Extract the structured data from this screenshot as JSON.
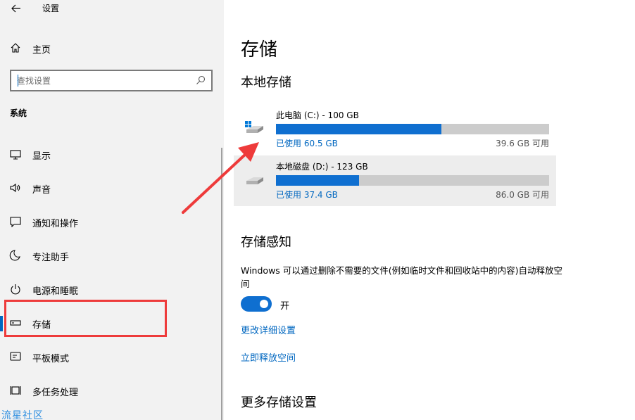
{
  "window": {
    "title": "设置"
  },
  "sidebar": {
    "home_label": "主页",
    "search_placeholder": "查找设置",
    "section_label": "系统",
    "items": [
      {
        "label": "显示",
        "icon": "monitor-icon"
      },
      {
        "label": "声音",
        "icon": "speaker-icon"
      },
      {
        "label": "通知和操作",
        "icon": "message-icon"
      },
      {
        "label": "专注助手",
        "icon": "moon-icon"
      },
      {
        "label": "电源和睡眠",
        "icon": "power-icon"
      },
      {
        "label": "存储",
        "icon": "storage-icon",
        "active": true
      },
      {
        "label": "平板模式",
        "icon": "tablet-icon"
      },
      {
        "label": "多任务处理",
        "icon": "multitask-icon"
      }
    ]
  },
  "main": {
    "title": "存储",
    "local_storage_heading": "本地存储",
    "drives": [
      {
        "name": "此电脑 (C:) - 100 GB",
        "used": "已使用 60.5 GB",
        "free": "39.6 GB 可用",
        "used_fraction": 0.605,
        "icon": "system-drive-icon"
      },
      {
        "name": "本地磁盘 (D:) - 123 GB",
        "used": "已使用 37.4 GB",
        "free": "86.0 GB 可用",
        "used_fraction": 0.304,
        "icon": "local-drive-icon"
      }
    ],
    "storage_sense_heading": "存储感知",
    "storage_sense_desc": "Windows 可以通过删除不需要的文件(例如临时文件和回收站中的内容)自动释放空间",
    "toggle_state_label": "开",
    "toggle_on": true,
    "link_change_settings": "更改详细设置",
    "link_free_space": "立即释放空间",
    "more_settings_heading": "更多存储设置"
  },
  "watermark": "流星社区",
  "colors": {
    "accent": "#0067c0",
    "bar_fill": "#0f6fd0",
    "annotation": "#ee3b3b"
  }
}
